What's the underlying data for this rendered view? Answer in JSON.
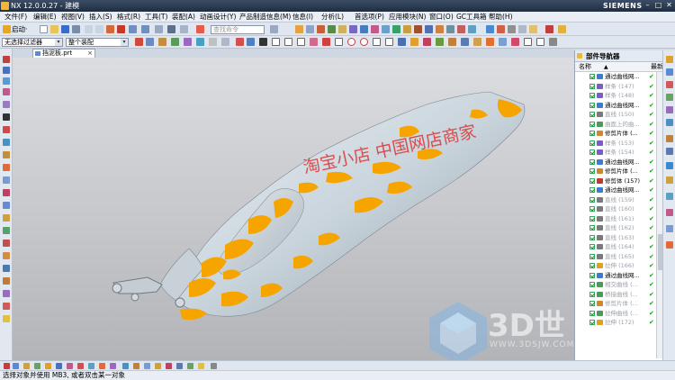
{
  "titlebar": {
    "title": "NX 12.0.0.27 - 建模",
    "brand": "SIEMENS",
    "minimize": "–",
    "maximize": "□",
    "close": "✕"
  },
  "menubar": {
    "items": [
      "文件(F)",
      "编辑(E)",
      "视图(V)",
      "插入(S)",
      "格式(R)",
      "工具(T)",
      "装配(A)",
      "动画设计(Y)",
      "产品制造信息(M)",
      "信息(I)",
      "分析(L)",
      "首选项(P)",
      "应用模块(N)",
      "窗口(O)",
      "GC工具箱",
      "帮助(H)"
    ]
  },
  "toolbar": {
    "start_label": "启动·",
    "search_placeholder": "查找命令",
    "selection_filter": "无选择过滤器",
    "assembly_scope": "整个装配"
  },
  "document": {
    "tab_label": "挡泥板.prt"
  },
  "viewport": {
    "watermark_text": "淘宝小店 中国网店商家",
    "logo_text": "3D世",
    "logo_subtext": "WWW.3DSJW.COM",
    "model_colors": {
      "surface": "#c9d4dc",
      "highlight": "#f5a400"
    }
  },
  "navigator": {
    "title": "部件导航器",
    "col_name": "名称",
    "col_latest": "最新",
    "items": [
      {
        "label": "通过曲线网...",
        "icon": "#3a7bd5",
        "suppressed": false
      },
      {
        "label": "样条 (147)",
        "icon": "#7a5cc7",
        "suppressed": true
      },
      {
        "label": "样条 (148)",
        "icon": "#7a5cc7",
        "suppressed": true
      },
      {
        "label": "通过曲线网...",
        "icon": "#3a7bd5",
        "suppressed": false
      },
      {
        "label": "直线 (150)",
        "icon": "#7a7a7a",
        "suppressed": true
      },
      {
        "label": "曲面上的曲...",
        "icon": "#4a9a5a",
        "suppressed": true
      },
      {
        "label": "修剪片体 (...",
        "icon": "#d0862a",
        "suppressed": false
      },
      {
        "label": "样条 (153)",
        "icon": "#7a5cc7",
        "suppressed": true
      },
      {
        "label": "样条 (154)",
        "icon": "#7a5cc7",
        "suppressed": true
      },
      {
        "label": "通过曲线网...",
        "icon": "#3a7bd5",
        "suppressed": false
      },
      {
        "label": "修剪片体 (...",
        "icon": "#d0862a",
        "suppressed": false
      },
      {
        "label": "修剪体 (157)",
        "icon": "#c0392b",
        "suppressed": false
      },
      {
        "label": "通过曲线网...",
        "icon": "#3a7bd5",
        "suppressed": false
      },
      {
        "label": "直线 (159)",
        "icon": "#7a7a7a",
        "suppressed": true
      },
      {
        "label": "直线 (160)",
        "icon": "#7a7a7a",
        "suppressed": true
      },
      {
        "label": "直线 (161)",
        "icon": "#7a7a7a",
        "suppressed": true
      },
      {
        "label": "直线 (162)",
        "icon": "#7a7a7a",
        "suppressed": true
      },
      {
        "label": "直线 (163)",
        "icon": "#7a7a7a",
        "suppressed": true
      },
      {
        "label": "直线 (164)",
        "icon": "#7a7a7a",
        "suppressed": true
      },
      {
        "label": "直线 (165)",
        "icon": "#7a7a7a",
        "suppressed": true
      },
      {
        "label": "拉伸 (166)",
        "icon": "#e0a020",
        "suppressed": true
      },
      {
        "label": "通过曲线网...",
        "icon": "#3a7bd5",
        "suppressed": false
      },
      {
        "label": "相交曲线 (...",
        "icon": "#4a9a5a",
        "suppressed": true
      },
      {
        "label": "桥接曲线 (...",
        "icon": "#4a9a5a",
        "suppressed": true
      },
      {
        "label": "修剪片体 (...",
        "icon": "#d0862a",
        "suppressed": true
      },
      {
        "label": "拉伸曲线 (...",
        "icon": "#4a9a5a",
        "suppressed": true
      },
      {
        "label": "拉伸 (172)",
        "icon": "#e0a020",
        "suppressed": true
      }
    ]
  },
  "statusbar": {
    "prompt": "选择对象并使用 MB3, 或者双击某一对象"
  }
}
